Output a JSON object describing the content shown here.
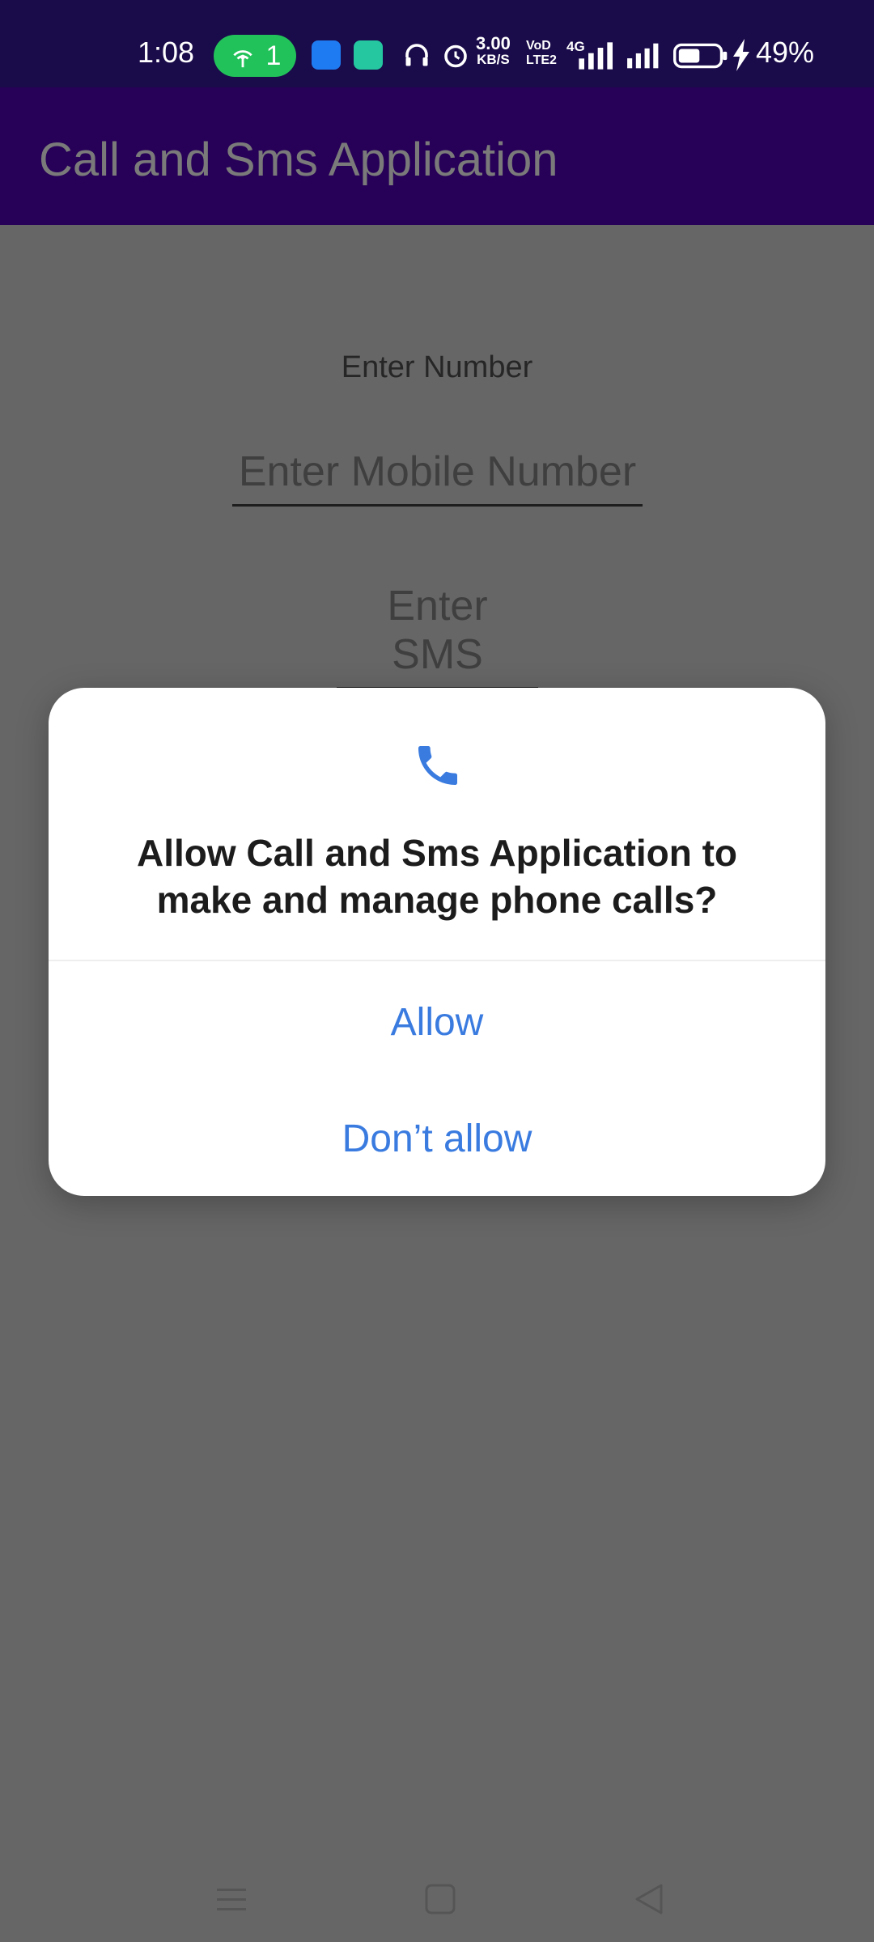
{
  "status_bar": {
    "time": "1:08",
    "hotspot_count": "1",
    "net_speed_value": "3.00",
    "net_speed_unit": "KB/S",
    "volte_top": "VoD",
    "volte_bottom": "LTE2",
    "network_type": "4G",
    "battery_percent": "49%",
    "icons": [
      "hotspot-icon",
      "android-app-icon",
      "battery-saver-app-icon",
      "headphones-icon",
      "alarm-icon",
      "signal-icon",
      "signal-icon",
      "battery-icon",
      "charging-bolt-icon"
    ]
  },
  "app_bar": {
    "title": "Call and Sms Application"
  },
  "form": {
    "number_label": "Enter Number",
    "mobile_placeholder": "Enter Mobile Number",
    "sms_placeholder": "Enter SMS"
  },
  "dialog": {
    "icon": "phone-icon",
    "message": "Allow Call and Sms Application to make and manage phone calls?",
    "allow_label": "Allow",
    "deny_label": "Don’t allow"
  },
  "nav_bar": {
    "icons": [
      "menu-icon",
      "home-icon",
      "back-icon"
    ]
  },
  "colors": {
    "status_bar_bg": "#1a0b4a",
    "app_bar_bg": "#270058",
    "scrim": "#666666",
    "accent_blue": "#3a7be0",
    "hotspot_green": "#22c25a"
  }
}
